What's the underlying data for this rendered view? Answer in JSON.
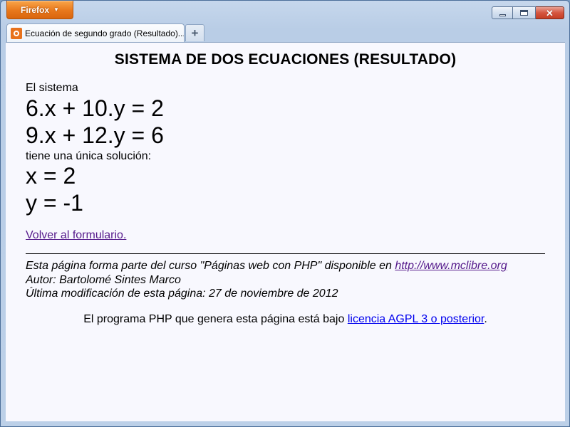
{
  "browser": {
    "app_button": "Firefox",
    "tab": {
      "title": "Ecuación de segundo grado (Resultado)...."
    },
    "new_tab_label": "+"
  },
  "page": {
    "title": "SISTEMA DE DOS ECUACIONES (RESULTADO)",
    "intro": "El sistema",
    "equations": [
      "6.x + 10.y = 2",
      "9.x + 12.y = 6"
    ],
    "solution_intro": "tiene una única solución:",
    "solution": [
      "x = 2",
      "y = -1"
    ],
    "back_link": "Volver al formulario."
  },
  "footer": {
    "course_prefix": "Esta página forma parte del curso \"Páginas web con PHP\" disponible en ",
    "course_link": "http://www.mclibre.org",
    "author": "Autor: Bartolomé Sintes Marco",
    "last_modified": "Última modificación de esta página: 27 de noviembre de 2012",
    "license_prefix": "El programa PHP que genera esta página está bajo ",
    "license_link": "licencia AGPL 3 o posterior",
    "license_suffix": "."
  }
}
